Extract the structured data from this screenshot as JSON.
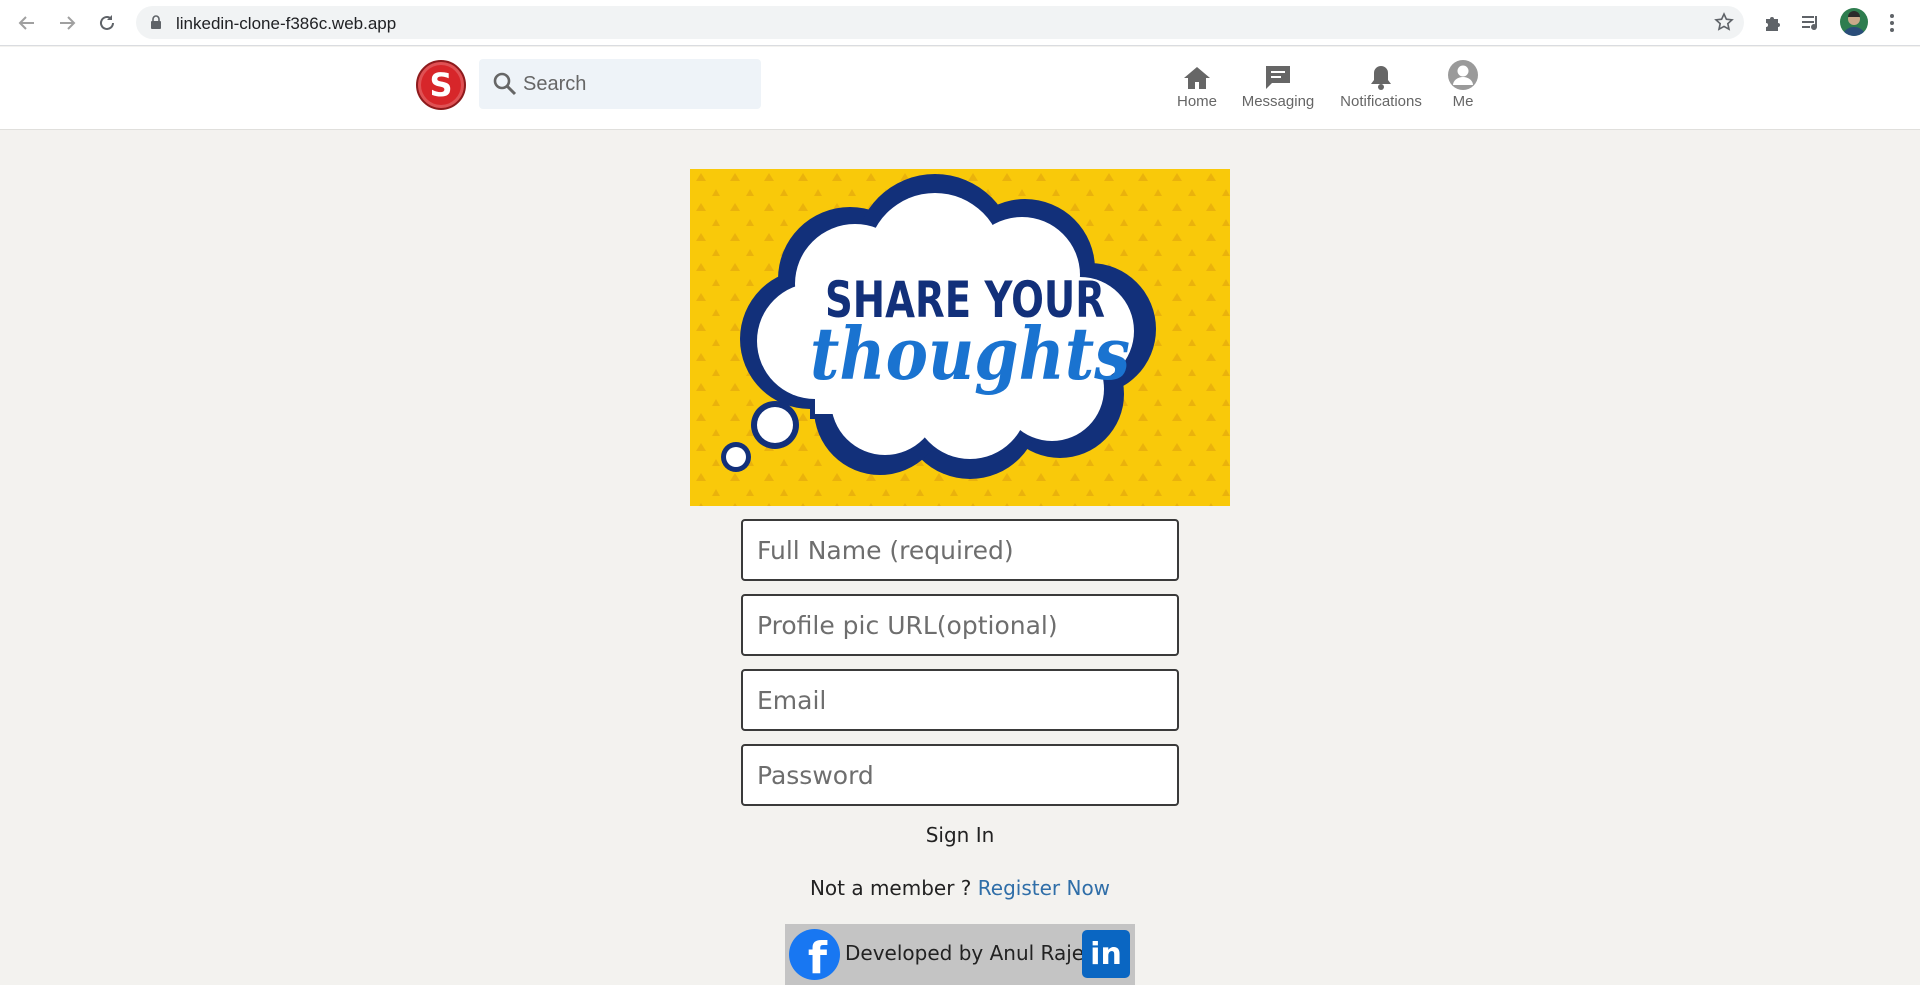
{
  "browser": {
    "url": "linkedin-clone-f386c.web.app",
    "icons": [
      "back-icon",
      "forward-icon",
      "reload-icon",
      "lock-icon",
      "star-icon",
      "extensions-icon",
      "media-icon",
      "more-icon"
    ]
  },
  "header": {
    "logo_letter": "S",
    "search_placeholder": "Search",
    "nav": [
      {
        "label": "Home",
        "icon": "home-icon"
      },
      {
        "label": "Messaging",
        "icon": "messaging-icon"
      },
      {
        "label": "Notifications",
        "icon": "bell-icon"
      },
      {
        "label": "Me",
        "icon": "user-avatar-icon"
      }
    ]
  },
  "banner": {
    "line1": "SHARE YOUR",
    "line2": "thoughts"
  },
  "form": {
    "full_name_placeholder": "Full Name (required)",
    "profile_pic_placeholder": "Profile pic URL(optional)",
    "email_placeholder": "Email",
    "password_placeholder": "Password",
    "sign_in_label": "Sign In",
    "not_member_text": "Not a member ? ",
    "register_label": "Register Now"
  },
  "footer": {
    "facebook_letter": "f",
    "developed_by": "Developed by Anul Rajeev",
    "linkedin_text": "in"
  },
  "colors": {
    "page_bg": "#f3f2ef",
    "banner_yellow": "#f9c90a",
    "banner_navy": "#12307a",
    "banner_blue": "#1a73d0",
    "link_blue": "#2f6ea8",
    "logo_red": "#d7262a",
    "facebook_blue": "#1877f2",
    "linkedin_blue": "#0a66c2"
  }
}
